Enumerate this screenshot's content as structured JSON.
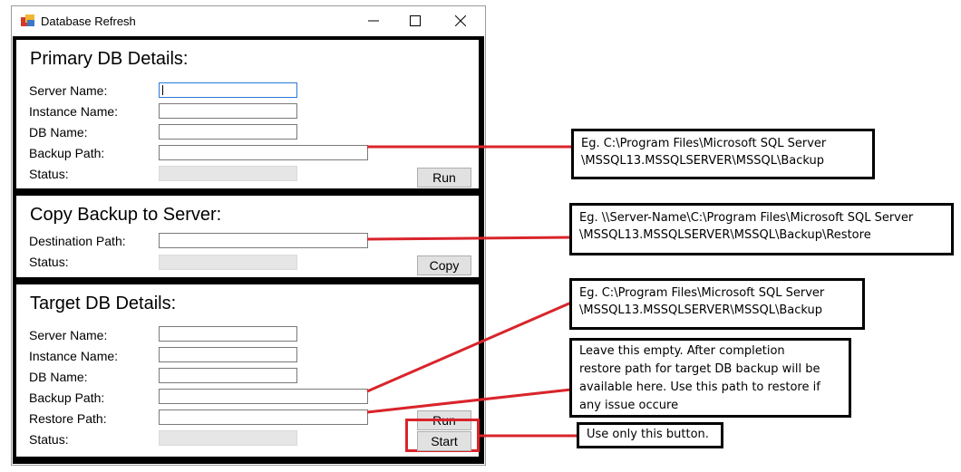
{
  "window": {
    "title": "Database Refresh"
  },
  "primary": {
    "heading": "Primary DB Details:",
    "server_label": "Server Name:",
    "instance_label": "Instance Name:",
    "db_label": "DB Name:",
    "backup_label": "Backup Path:",
    "status_label": "Status:",
    "run_button": "Run"
  },
  "copy": {
    "heading": "Copy Backup to Server:",
    "dest_label": "Destination Path:",
    "status_label": "Status:",
    "copy_button": "Copy"
  },
  "target": {
    "heading": "Target DB Details:",
    "server_label": "Server Name:",
    "instance_label": "Instance Name:",
    "db_label": "DB Name:",
    "backup_label": "Backup Path:",
    "restore_label": "Restore Path:",
    "status_label": "Status:",
    "run_button": "Run",
    "start_button": "Start"
  },
  "callouts": {
    "primary_backup": [
      "Eg.   C:\\Program Files\\Microsoft SQL Server",
      "\\MSSQL13.MSSQLSERVER\\MSSQL\\Backup"
    ],
    "copy_dest": [
      "Eg. \\\\Server-Name\\C:\\Program Files\\Microsoft SQL Server",
      "\\MSSQL13.MSSQLSERVER\\MSSQL\\Backup\\Restore"
    ],
    "target_backup": [
      "Eg.   C:\\Program Files\\Microsoft SQL Server",
      "\\MSSQL13.MSSQLSERVER\\MSSQL\\Backup"
    ],
    "restore": [
      "Leave this empty. After completion",
      "restore path for target DB backup will be",
      "available here. Use this path to restore if",
      "any issue occure"
    ],
    "start": [
      "Use only this button."
    ]
  },
  "colors": {
    "annotation": "#d9242b",
    "focus": "#2b79d7"
  },
  "icons": [
    "app-icon",
    "minimize-icon",
    "maximize-icon",
    "close-icon"
  ]
}
